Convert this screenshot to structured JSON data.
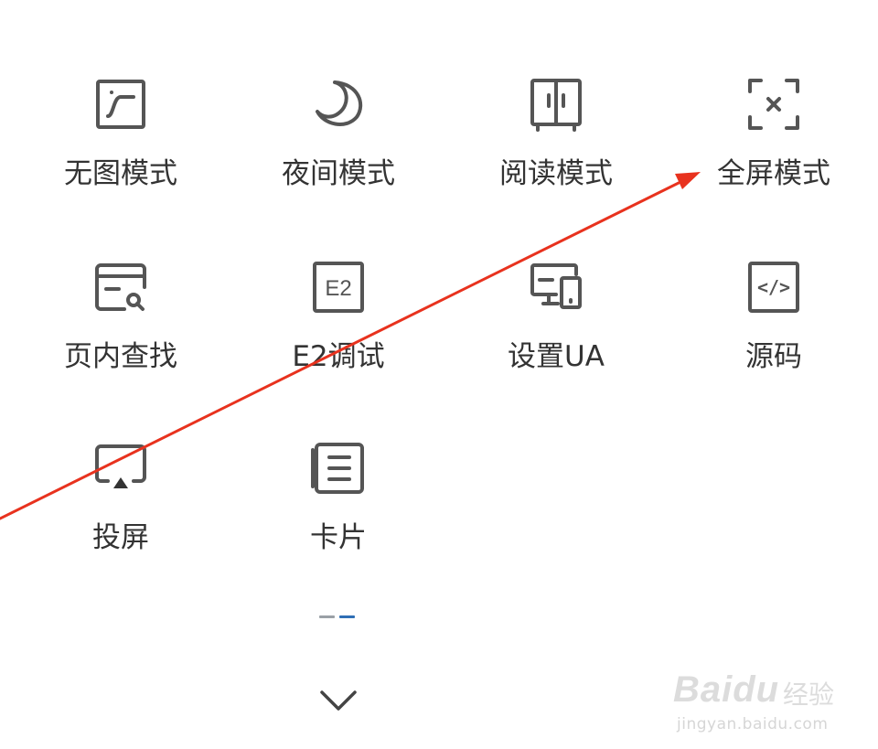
{
  "menu": {
    "items": [
      {
        "label": "无图模式",
        "icon": "no-image-icon"
      },
      {
        "label": "夜间模式",
        "icon": "moon-icon"
      },
      {
        "label": "阅读模式",
        "icon": "book-icon"
      },
      {
        "label": "全屏模式",
        "icon": "fullscreen-icon"
      },
      {
        "label": "页内查找",
        "icon": "find-in-page-icon"
      },
      {
        "label": "E2调试",
        "icon": "e2-debug-icon"
      },
      {
        "label": "设置UA",
        "icon": "devices-icon"
      },
      {
        "label": "源码",
        "icon": "source-code-icon"
      },
      {
        "label": "投屏",
        "icon": "cast-screen-icon"
      },
      {
        "label": "卡片",
        "icon": "card-icon"
      }
    ],
    "e2_icon_text": "E2",
    "source_icon_text": "</>"
  },
  "pagination": {
    "pages": 2,
    "current": 2
  },
  "collapse": {
    "icon": "chevron-down-icon"
  },
  "annotation": {
    "type": "red-arrow",
    "color": "#e8321e",
    "points_to": "全屏模式"
  },
  "watermark": {
    "brand": "Baidu",
    "sub": "经验",
    "url": "jingyan.baidu.com"
  },
  "colors": {
    "icon_stroke": "#555555",
    "label_text": "#333333",
    "indicator_inactive": "#9aa0a6",
    "indicator_active": "#2f6fb5",
    "watermark": "#dcdcdc"
  }
}
